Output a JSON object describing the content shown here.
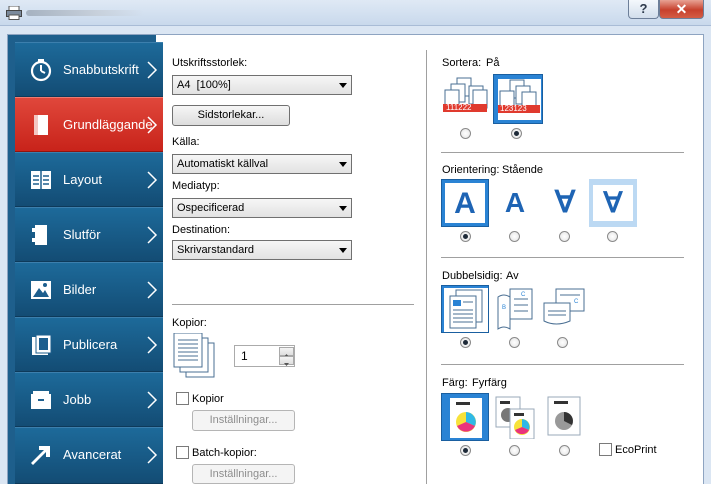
{
  "window": {
    "help_glyph": "?",
    "close_glyph": "✕"
  },
  "sidebar": {
    "items": [
      {
        "label": "Snabbutskrift",
        "icon": "stopwatch-icon",
        "active": false
      },
      {
        "label": "Grundläggande",
        "icon": "page-icon",
        "active": true
      },
      {
        "label": "Layout",
        "icon": "layout-icon",
        "active": false
      },
      {
        "label": "Slutför",
        "icon": "finishing-icon",
        "active": false
      },
      {
        "label": "Bilder",
        "icon": "image-icon",
        "active": false
      },
      {
        "label": "Publicera",
        "icon": "publish-icon",
        "active": false
      },
      {
        "label": "Jobb",
        "icon": "job-icon",
        "active": false
      },
      {
        "label": "Avancerat",
        "icon": "arrow-icon",
        "active": false
      }
    ]
  },
  "basic": {
    "print_size_label": "Utskriftsstorlek:",
    "print_size_value": "A4  [100%]",
    "page_sizes_button": "Sidstorlekar...",
    "source_label": "Källa:",
    "source_value": "Automatiskt källval",
    "media_type_label": "Mediatyp:",
    "media_type_value": "Ospecificerad",
    "destination_label": "Destination:",
    "destination_value": "Skrivarstandard",
    "copies_label": "Kopior:",
    "copies_value": "1",
    "copies_checkbox_label": "Kopior",
    "copies_settings_button": "Inställningar...",
    "batch_checkbox_label": "Batch-kopior:",
    "batch_settings_button": "Inställningar..."
  },
  "collate": {
    "label": "Sortera:",
    "value": "På",
    "icon_text_a": "111222",
    "icon_text_b": "123123"
  },
  "orientation": {
    "label": "Orientering:",
    "value": "Stående",
    "glyph": "A",
    "glyph_rotated": "∀"
  },
  "duplex": {
    "label": "Dubbelsidig:",
    "value": "Av"
  },
  "color": {
    "label": "Färg:",
    "value": "Fyrfärg",
    "ecoprint_label": "EcoPrint"
  },
  "colors": {
    "accent_blue": "#2a83d4",
    "active_red": "#d8342a",
    "nav_blue": "#1a5c8a"
  }
}
